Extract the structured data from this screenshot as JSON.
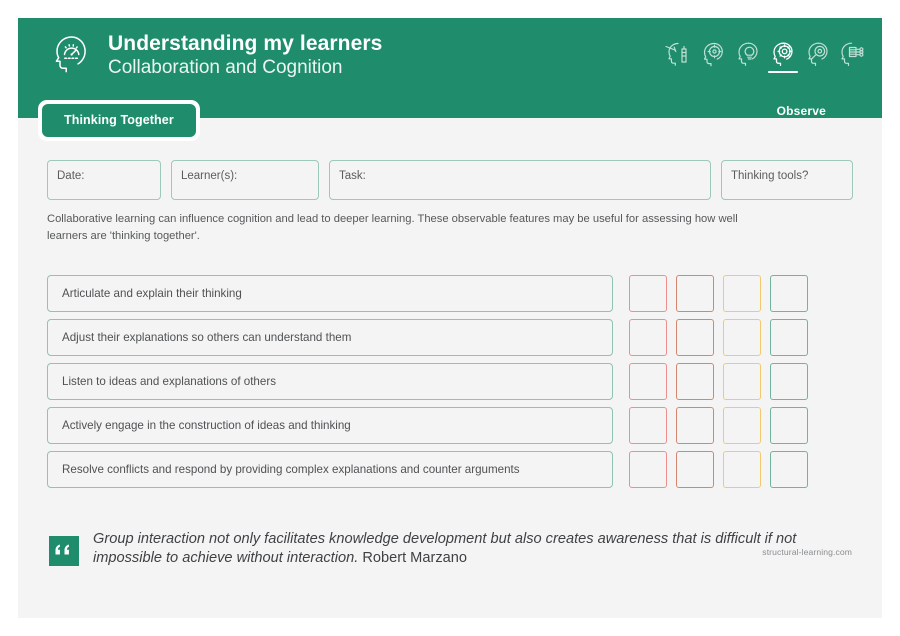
{
  "header": {
    "logo_icon": "head-gauge-icon",
    "title": "Understanding my learners",
    "subtitle": "Collaboration and Cognition",
    "accent_color": "#1f8d6b",
    "observe_label": "Observe",
    "stage_icons": [
      {
        "name": "head-explore-icon",
        "active": false
      },
      {
        "name": "head-target-icon",
        "active": false
      },
      {
        "name": "head-lightbulb-icon",
        "active": false
      },
      {
        "name": "head-gear-icon",
        "active": true
      },
      {
        "name": "head-eye-icon",
        "active": false
      },
      {
        "name": "head-network-icon",
        "active": false
      }
    ]
  },
  "tab": {
    "label": "Thinking Together"
  },
  "fields": [
    {
      "name": "date",
      "label": "Date:",
      "value": ""
    },
    {
      "name": "learners",
      "label": "Learner(s):",
      "value": ""
    },
    {
      "name": "task",
      "label": "Task:",
      "value": ""
    },
    {
      "name": "thinking-tools",
      "label": "Thinking tools?",
      "value": ""
    }
  ],
  "intro": "Collaborative learning can influence cognition and lead to deeper learning. These observable features may be useful for assessing how well learners are 'thinking together'.",
  "checklist": {
    "column_colors": [
      "#ef8e8e",
      "#d4866f",
      "#f2ca6b",
      "#6fb3a0"
    ],
    "statements": [
      "Articulate and explain their thinking",
      "Adjust their explanations so others can understand them",
      "Listen to ideas and explanations of others",
      "Actively engage in the construction of ideas and thinking",
      "Resolve conflicts and respond by providing complex explanations and counter arguments"
    ]
  },
  "quote": {
    "text": "Group interaction not only facilitates knowledge development but also creates awareness that is difficult if not impossible to achieve without interaction.",
    "author": "Robert Marzano",
    "mark_icon": "quote-mark-icon"
  },
  "footer": {
    "credit": "structural-learning.com"
  }
}
